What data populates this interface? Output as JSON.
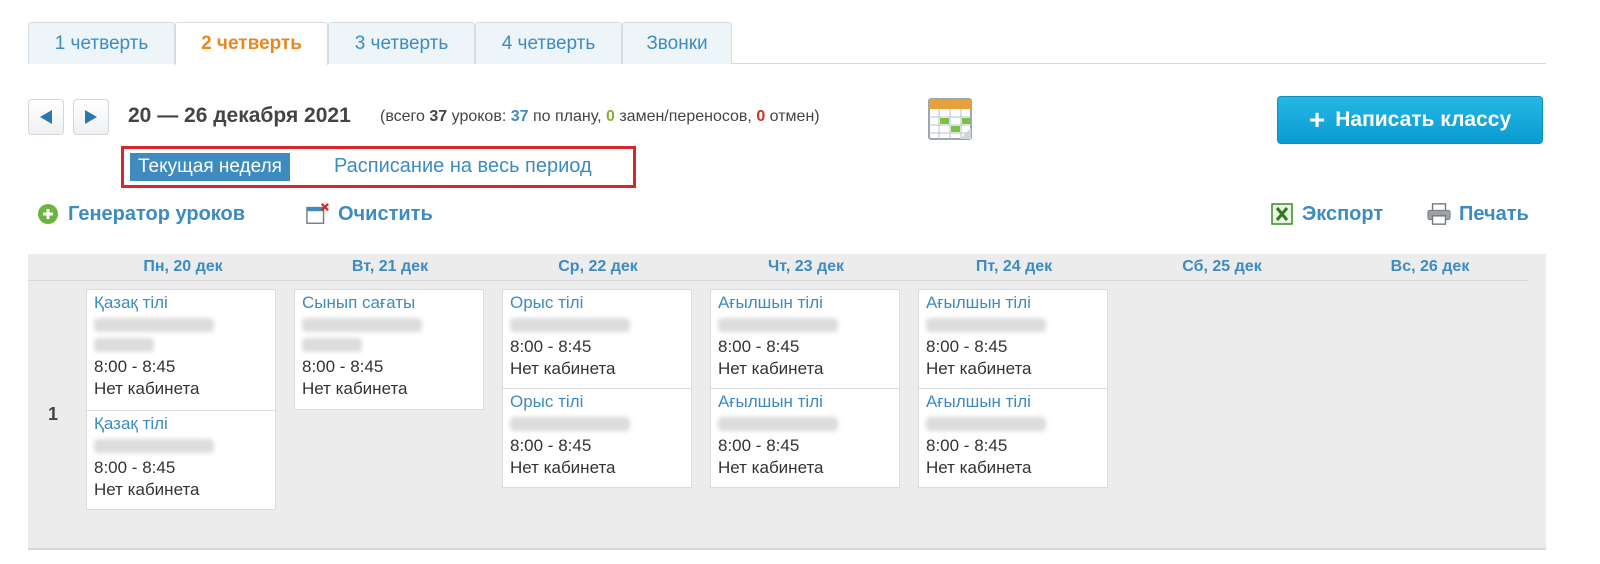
{
  "tabs": [
    "1 четверть",
    "2 четверть",
    "3 четверть",
    "4 четверть",
    "Звонки"
  ],
  "active_tab": "2 четверть",
  "week": {
    "range": "20 — 26 декабря 2021",
    "stats_prefix": "(всего ",
    "total": "37",
    "stats_mid1": " уроков: ",
    "plan": "37",
    "stats_mid2": " по плану, ",
    "substitutions": "0",
    "stats_mid3": " замен/переносов, ",
    "cancellations": "0",
    "stats_suffix": " отмен)"
  },
  "write_button": {
    "icon": "plus-icon",
    "label": "Написать классу"
  },
  "views": {
    "current": "Текущая неделя",
    "all": "Расписание на весь период"
  },
  "tools": {
    "generator": "Генератор уроков",
    "clear": "Очистить",
    "export": "Экспорт",
    "print": "Печать"
  },
  "days": [
    "Пн, 20 дек",
    "Вт, 21 дек",
    "Ср, 22 дек",
    "Чт, 23 дек",
    "Пт, 24 дек",
    "Сб, 25 дек",
    "Вс, 26 дек"
  ],
  "row_number": "1",
  "lessons": [
    {
      "day": "Пн, 20 дек",
      "subject": "Қазақ тілі",
      "time": "8:00 - 8:45",
      "room": "Нет кабинета"
    },
    {
      "day": "Пн, 20 дек",
      "subject": "Қазақ тілі",
      "time": "8:00 - 8:45",
      "room": "Нет кабинета"
    },
    {
      "day": "Вт, 21 дек",
      "subject": "Сынып сағаты",
      "time": "8:00 - 8:45",
      "room": "Нет кабинета"
    },
    {
      "day": "Ср, 22 дек",
      "subject": "Орыс тілі",
      "time": "8:00 - 8:45",
      "room": "Нет кабинета"
    },
    {
      "day": "Ср, 22 дек",
      "subject": "Орыс тілі",
      "time": "8:00 - 8:45",
      "room": "Нет кабинета"
    },
    {
      "day": "Чт, 23 дек",
      "subject": "Ағылшын тілі",
      "time": "8:00 - 8:45",
      "room": "Нет кабинета"
    },
    {
      "day": "Чт, 23 дек",
      "subject": "Ағылшын тілі",
      "time": "8:00 - 8:45",
      "room": "Нет кабинета"
    },
    {
      "day": "Пт, 24 дек",
      "subject": "Ағылшын тілі",
      "time": "8:00 - 8:45",
      "room": "Нет кабинета"
    },
    {
      "day": "Пт, 24 дек",
      "subject": "Ағылшын тілі",
      "time": "8:00 - 8:45",
      "room": "Нет кабинета"
    }
  ],
  "colors": {
    "link": "#3d8bbf",
    "active_tab": "#e7891e",
    "plan_count": "#3d8bbf",
    "substitution_count": "#8ab032",
    "cancel_count": "#d03022",
    "highlight_border": "#d7262d",
    "primary_button": "#0a9bd0"
  }
}
